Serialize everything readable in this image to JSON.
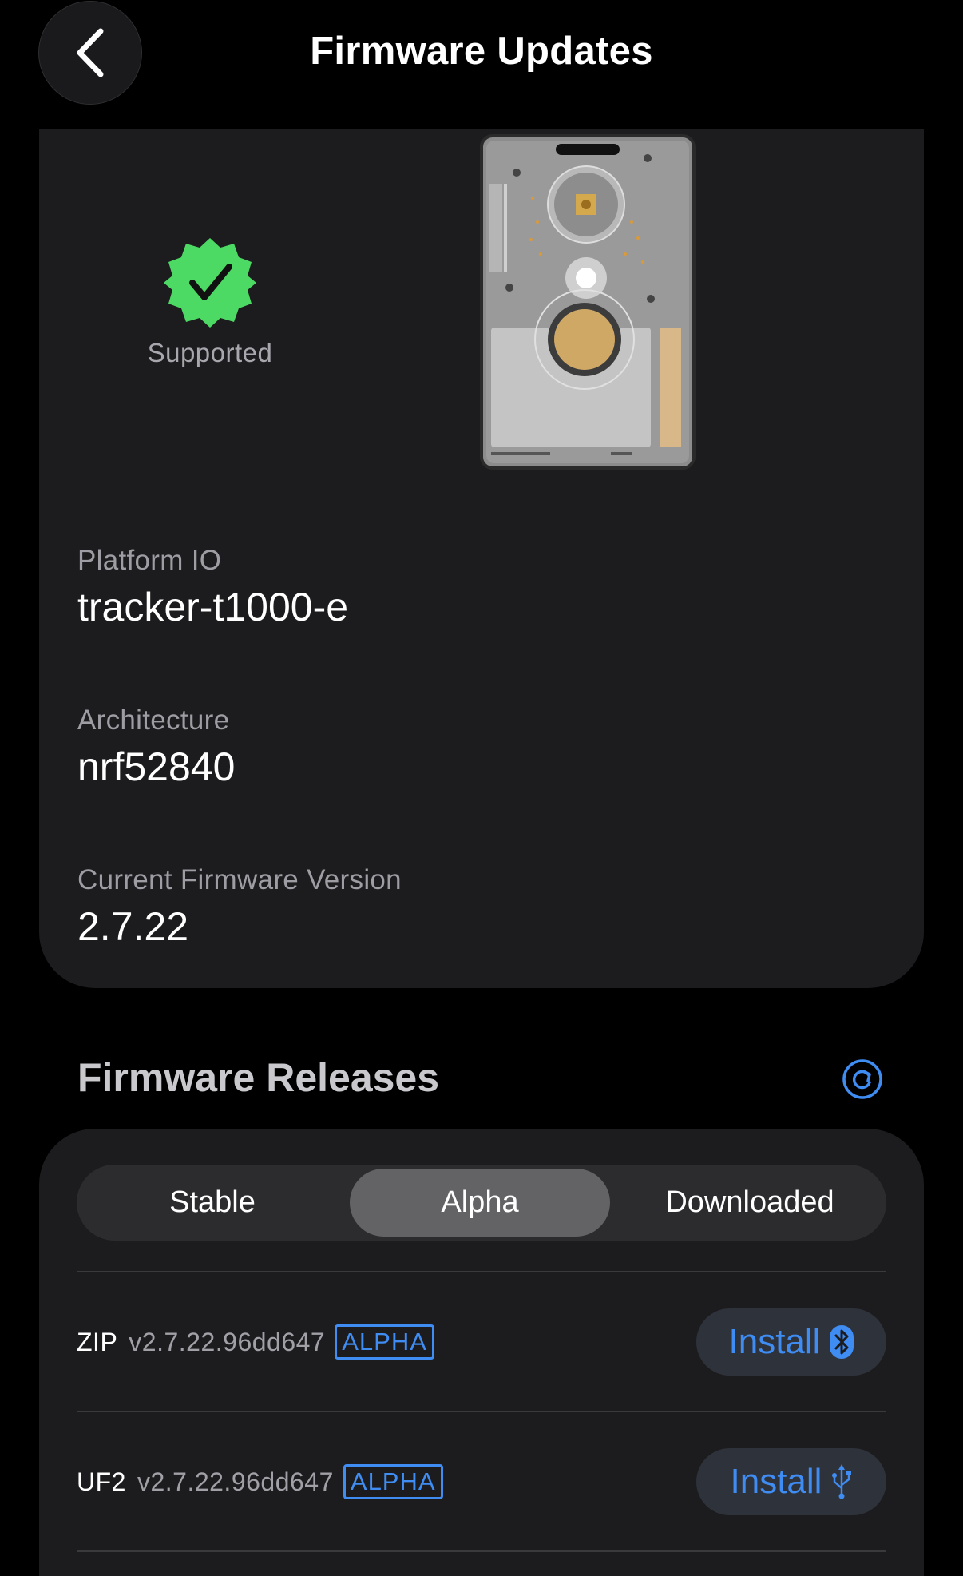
{
  "header": {
    "title": "Firmware Updates"
  },
  "device": {
    "support_status": "Supported",
    "fields": [
      {
        "label": "Platform IO",
        "value": "tracker-t1000-e"
      },
      {
        "label": "Architecture",
        "value": "nrf52840"
      },
      {
        "label": "Current Firmware Version",
        "value": "2.7.22"
      }
    ]
  },
  "releases": {
    "section_title": "Firmware Releases",
    "tabs": [
      {
        "label": "Stable",
        "selected": false
      },
      {
        "label": "Alpha",
        "selected": true
      },
      {
        "label": "Downloaded",
        "selected": false
      }
    ],
    "items": [
      {
        "type": "ZIP",
        "version": "v2.7.22.96dd647",
        "tag": "ALPHA",
        "action": "Install",
        "action_icon": "bluetooth-icon"
      },
      {
        "type": "UF2",
        "version": "v2.7.22.96dd647",
        "tag": "ALPHA",
        "action": "Install",
        "action_icon": "usb-icon"
      }
    ]
  },
  "colors": {
    "accent": "#3f8cf2",
    "badge_green": "#4cd964",
    "card_bg": "#1c1c1e",
    "page_bg": "#000000"
  }
}
